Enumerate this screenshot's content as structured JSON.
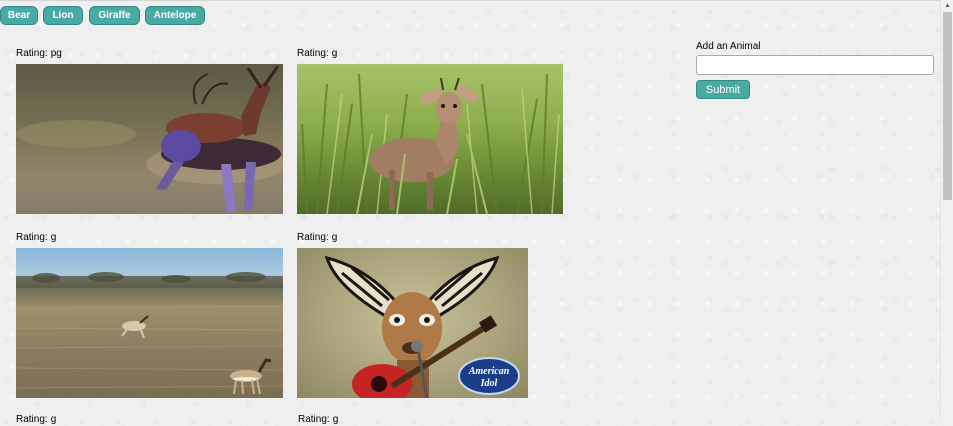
{
  "animal_buttons": [
    {
      "label": "Bear"
    },
    {
      "label": "Lion"
    },
    {
      "label": "Giraffe"
    },
    {
      "label": "Antelope"
    }
  ],
  "gifs": [
    {
      "rating_label": "Rating:",
      "rating": "pg"
    },
    {
      "rating_label": "Rating:",
      "rating": "g"
    },
    {
      "rating_label": "Rating:",
      "rating": "g"
    },
    {
      "rating_label": "Rating:",
      "rating": "g"
    },
    {
      "rating_label": "Rating:",
      "rating": "g"
    },
    {
      "rating_label": "Rating:",
      "rating": "g"
    }
  ],
  "gif4_logo_text": [
    "American",
    "Idol"
  ],
  "form": {
    "label": "Add an Animal",
    "input_value": "",
    "submit_label": "Submit"
  },
  "colors": {
    "button_teal": "#4aa9a2",
    "button_border": "#2f8a84",
    "background": "#efefef"
  },
  "icons": {
    "scroll_up": "▲"
  }
}
